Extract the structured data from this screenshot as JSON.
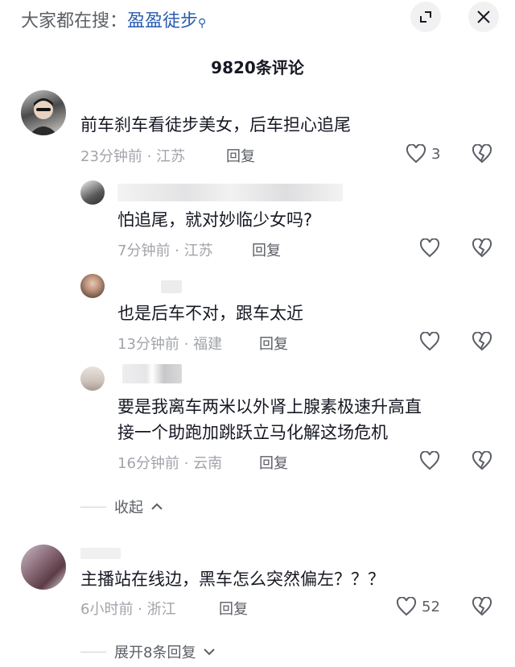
{
  "search_hint": {
    "prefix": "大家都在搜：",
    "keyword": "盈盈徒步"
  },
  "comment_count_title": "9820条评论",
  "comments": [
    {
      "text": "前车刹车看徒步美女，后车担心追尾",
      "time_location": "23分钟前 · 江苏",
      "reply_label": "回复",
      "likes": "3"
    },
    {
      "text": "怕追尾，就对妙临少女吗?",
      "time_location": "7分钟前 · 江苏",
      "reply_label": "回复"
    },
    {
      "text": "也是后车不对，跟车太近",
      "time_location": "13分钟前 · 福建",
      "reply_label": "回复"
    },
    {
      "text_line1": "要是我离车两米以外肾上腺素极速升高直",
      "text_line2": "接一个助跑加跳跃立马化解这场危机",
      "time_location": "16分钟前 · 云南",
      "reply_label": "回复"
    },
    {
      "text": "主播站在线边，黑车怎么突然偏左？？？",
      "time_location": "6小时前 · 浙江",
      "reply_label": "回复",
      "likes": "52"
    }
  ],
  "collapse_label": "收起",
  "expand_label": "展开8条回复",
  "colors": {
    "keyword": "#2a5db0",
    "text": "#161823",
    "meta": "#a2a4aa"
  }
}
